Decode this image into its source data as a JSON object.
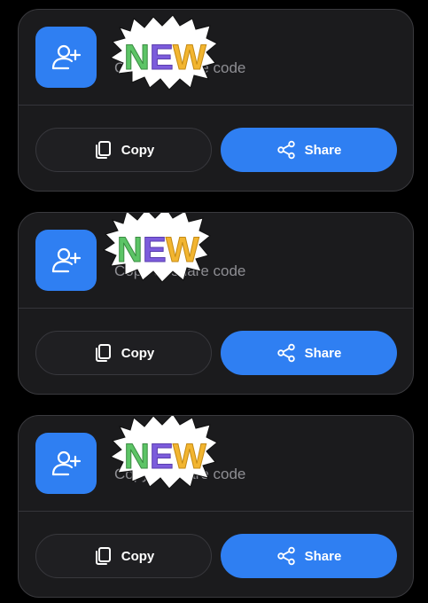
{
  "colors": {
    "page_background": "#000000",
    "card_background": "#1b1b1d",
    "accent_blue": "#2f7ff2",
    "subtitle_text": "#8e8e93",
    "badge_letter_n": "#5cc466",
    "badge_letter_e": "#7c5cdc",
    "badge_letter_w": "#f2b530"
  },
  "cards": [
    {
      "avatar_icon": "add-user-icon",
      "badge": {
        "letters": [
          "N",
          "E",
          "W"
        ]
      },
      "subtitle": "Copy or share code",
      "copy_label": "Copy",
      "copy_icon": "copy-icon",
      "share_label": "Share",
      "share_icon": "share-icon"
    },
    {
      "avatar_icon": "add-user-icon",
      "badge": {
        "letters": [
          "N",
          "E",
          "W"
        ]
      },
      "subtitle": "Copy or share code",
      "copy_label": "Copy",
      "copy_icon": "copy-icon",
      "share_label": "Share",
      "share_icon": "share-icon"
    },
    {
      "avatar_icon": "add-user-icon",
      "badge": {
        "letters": [
          "N",
          "E",
          "W"
        ]
      },
      "subtitle": "Copy or share code",
      "copy_label": "Copy",
      "copy_icon": "copy-icon",
      "share_label": "Share",
      "share_icon": "share-icon"
    }
  ]
}
